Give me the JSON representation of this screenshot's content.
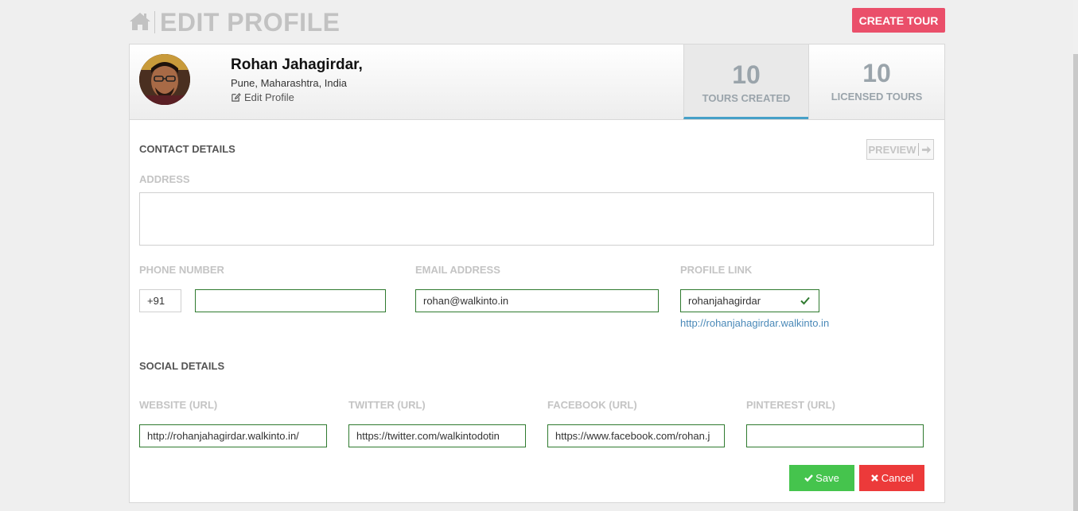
{
  "header": {
    "title": "EDIT PROFILE",
    "create_button": "CREATE TOUR"
  },
  "profile": {
    "name": "Rohan Jahagirdar,",
    "location": "Pune, Maharashtra, India",
    "edit_label": "Edit Profile"
  },
  "stats": [
    {
      "value": "10",
      "label": "TOURS CREATED"
    },
    {
      "value": "10",
      "label": "LICENSED TOURS"
    }
  ],
  "contact": {
    "section_title": "CONTACT DETAILS",
    "preview_label": "PREVIEW",
    "address_label": "ADDRESS",
    "address_value": "",
    "phone_label": "PHONE NUMBER",
    "phone_code": "+91",
    "phone_value": "",
    "email_label": "EMAIL ADDRESS",
    "email_value": "rohan@walkinto.in",
    "profile_link_label": "PROFILE LINK",
    "profile_link_value": "rohanjahagirdar",
    "profile_url": "http://rohanjahagirdar.walkinto.in"
  },
  "social": {
    "section_title": "SOCIAL DETAILS",
    "website_label": "WEBSITE (URL)",
    "website_value": "http://rohanjahagirdar.walkinto.in/",
    "twitter_label": "TWITTER (URL)",
    "twitter_value": "https://twitter.com/walkintodotin",
    "facebook_label": "FACEBOOK (URL)",
    "facebook_value": "https://www.facebook.com/rohan.j",
    "pinterest_label": "PINTEREST (URL)",
    "pinterest_value": ""
  },
  "actions": {
    "save_label": "Save",
    "cancel_label": "Cancel"
  },
  "colors": {
    "accent_pink": "#ea4f6a",
    "save_green": "#45c44d",
    "cancel_red": "#ec3a3a",
    "tab_underline": "#46a0c8",
    "link_blue": "#4a89b8"
  },
  "icons": [
    "home-icon",
    "edit-icon",
    "arrow-right-icon",
    "check-icon",
    "save-check-icon",
    "cancel-x-icon"
  ]
}
